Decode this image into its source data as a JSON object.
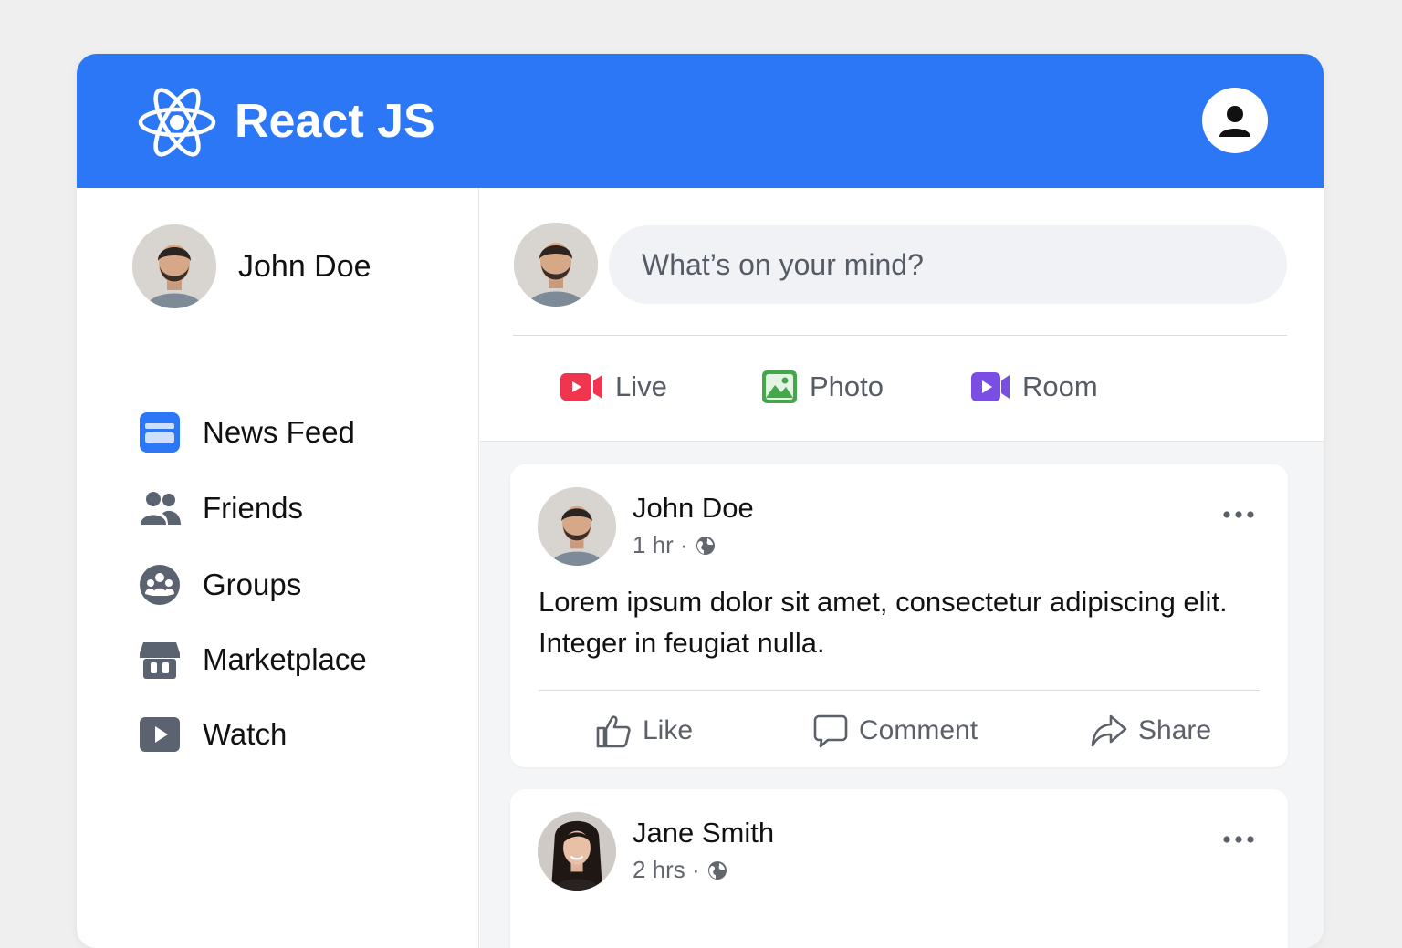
{
  "header": {
    "brand": "React JS",
    "logo_icon": "react-atom-icon",
    "profile_icon": "user-silhouette-icon",
    "color": "#2b77f5"
  },
  "sidebar": {
    "user": {
      "name": "John Doe"
    },
    "items": [
      {
        "label": "News Feed",
        "icon": "news-feed-icon",
        "color": "#2b77f5"
      },
      {
        "label": "Friends",
        "icon": "friends-icon",
        "color": "#5c6370"
      },
      {
        "label": "Groups",
        "icon": "groups-icon",
        "color": "#5c6370"
      },
      {
        "label": "Marketplace",
        "icon": "marketplace-icon",
        "color": "#5c6370"
      },
      {
        "label": "Watch",
        "icon": "watch-icon",
        "color": "#5c6370"
      }
    ]
  },
  "composer": {
    "placeholder": "What’s on your mind?",
    "actions": [
      {
        "label": "Live",
        "icon": "live-video-icon",
        "color": "#f0364f"
      },
      {
        "label": "Photo",
        "icon": "photo-icon",
        "color": "#44a84a"
      },
      {
        "label": "Room",
        "icon": "room-video-icon",
        "color": "#7a4ee3"
      }
    ]
  },
  "posts": [
    {
      "author": "John Doe",
      "time": "1 hr ·",
      "text": "Lorem ipsum dolor sit amet, consectetur adipiscing elit. Integer in feugiat nulla.",
      "actions": {
        "like": "Like",
        "comment": "Comment",
        "share": "Share"
      }
    },
    {
      "author": "Jane Smith",
      "time": "2 hrs ·"
    }
  ]
}
